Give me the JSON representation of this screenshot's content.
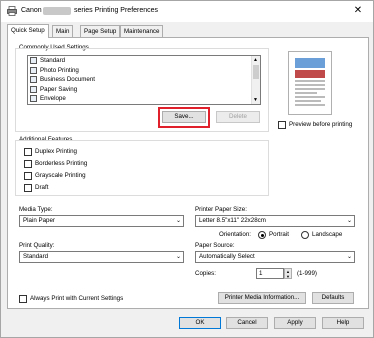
{
  "titlebar": {
    "brand": "Canon",
    "title_suffix": "series Printing Preferences",
    "close_glyph": "✕"
  },
  "tabs": [
    {
      "label": "Quick Setup"
    },
    {
      "label": "Main"
    },
    {
      "label": "Page Setup"
    },
    {
      "label": "Maintenance"
    }
  ],
  "commonly_used": {
    "label": "Commonly Used Settings",
    "items": [
      "Standard",
      "Photo Printing",
      "Business Document",
      "Paper Saving",
      "Envelope"
    ],
    "save_label": "Save...",
    "delete_label": "Delete"
  },
  "preview_label": "Preview before printing",
  "additional": {
    "label": "Additional Features",
    "options": [
      "Duplex Printing",
      "Borderless Printing",
      "Grayscale Printing",
      "Draft"
    ]
  },
  "media_type": {
    "label": "Media Type:",
    "value": "Plain Paper"
  },
  "paper_size": {
    "label": "Printer Paper Size:",
    "value": "Letter 8.5\"x11\" 22x28cm"
  },
  "orientation": {
    "label": "Orientation:",
    "portrait": "Portrait",
    "landscape": "Landscape"
  },
  "print_quality": {
    "label": "Print Quality:",
    "value": "Standard"
  },
  "paper_source": {
    "label": "Paper Source:",
    "value": "Automatically Select"
  },
  "copies": {
    "label": "Copies:",
    "value": "1",
    "range": "(1-999)"
  },
  "always_print_label": "Always Print with Current Settings",
  "printer_media_info_label": "Printer Media Information...",
  "defaults_label": "Defaults",
  "footer": {
    "ok": "OK",
    "cancel": "Cancel",
    "apply": "Apply",
    "help": "Help"
  },
  "colors": {
    "highlight_box": "#e0202a"
  }
}
